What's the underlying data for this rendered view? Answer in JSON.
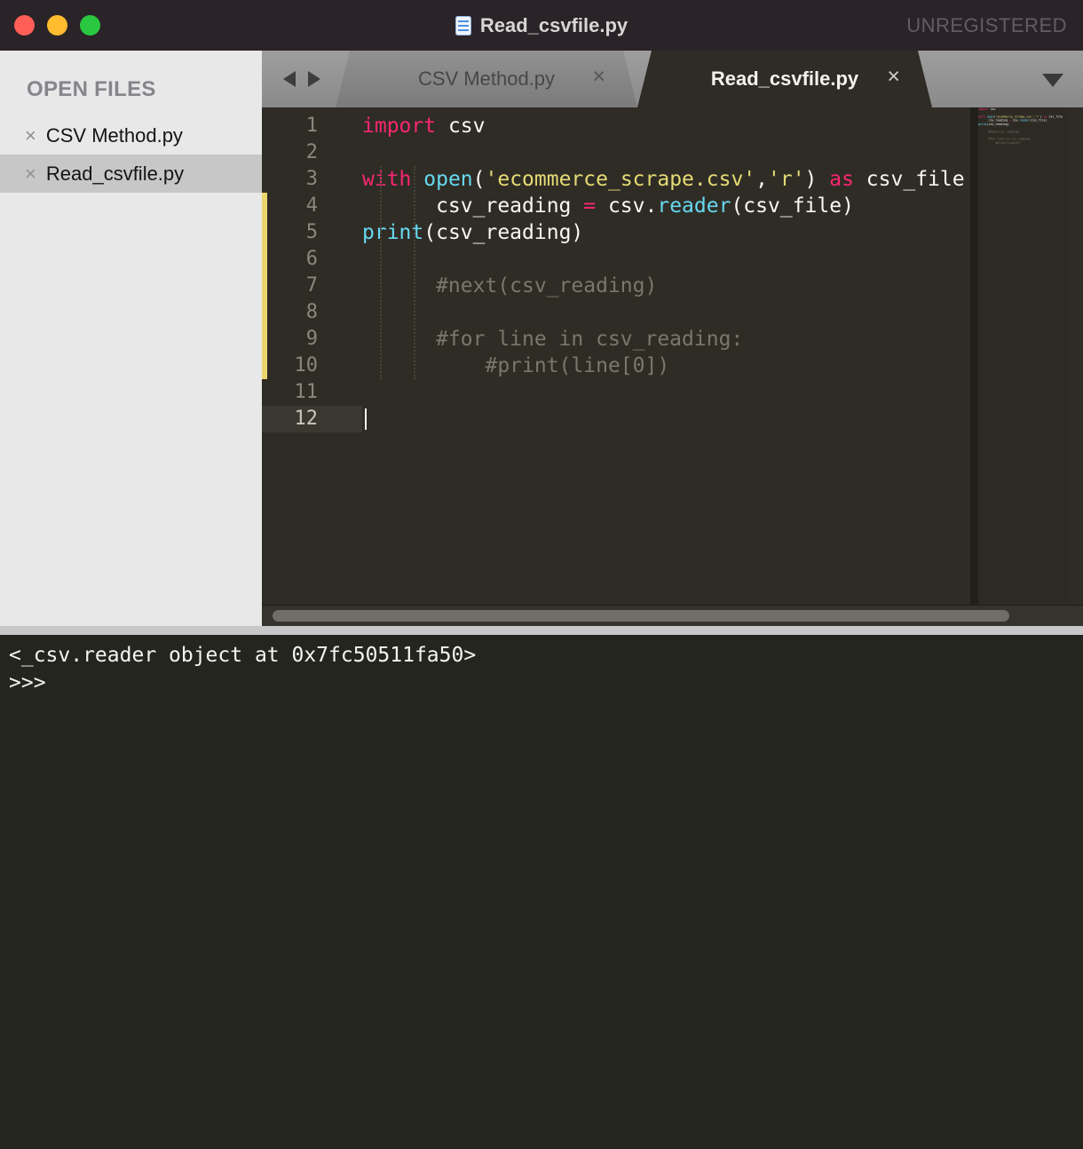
{
  "titlebar": {
    "title": "Read_csvfile.py",
    "registration": "UNREGISTERED"
  },
  "sidebar": {
    "heading": "OPEN FILES",
    "close_glyph": "×",
    "files": [
      {
        "name": "CSV Method.py",
        "selected": false
      },
      {
        "name": "Read_csvfile.py",
        "selected": true
      }
    ]
  },
  "tabstrip": {
    "close_glyph": "×",
    "tabs": [
      {
        "label": "CSV Method.py",
        "active": false
      },
      {
        "label": "Read_csvfile.py",
        "active": true
      }
    ]
  },
  "editor": {
    "current_line": "12",
    "lines": [
      {
        "n": "1",
        "segs": [
          [
            "kw",
            "import"
          ],
          [
            "pl",
            " csv"
          ]
        ]
      },
      {
        "n": "2",
        "segs": []
      },
      {
        "n": "3",
        "segs": [
          [
            "kw",
            "with"
          ],
          [
            "pl",
            " "
          ],
          [
            "fn",
            "open"
          ],
          [
            "pl",
            "("
          ],
          [
            "str",
            "'ecommerce_scrape.csv'"
          ],
          [
            "pl",
            ","
          ],
          [
            "str",
            "'r'"
          ],
          [
            "pl",
            ") "
          ],
          [
            "kw",
            "as"
          ],
          [
            "pl",
            " csv_file"
          ]
        ]
      },
      {
        "n": "4",
        "segs": [
          [
            "pl",
            "      csv_reading "
          ],
          [
            "kw",
            "="
          ],
          [
            "pl",
            " csv."
          ],
          [
            "fn",
            "reader"
          ],
          [
            "pl",
            "(csv_file)"
          ]
        ]
      },
      {
        "n": "5",
        "segs": [
          [
            "fn",
            "print"
          ],
          [
            "pl",
            "(csv_reading)"
          ]
        ]
      },
      {
        "n": "6",
        "segs": []
      },
      {
        "n": "7",
        "segs": [
          [
            "cm",
            "      #next(csv_reading)"
          ]
        ]
      },
      {
        "n": "8",
        "segs": []
      },
      {
        "n": "9",
        "segs": [
          [
            "cm",
            "      #for line in csv_reading:"
          ]
        ]
      },
      {
        "n": "10",
        "segs": [
          [
            "cm",
            "          #print(line[0])"
          ]
        ]
      },
      {
        "n": "11",
        "segs": []
      },
      {
        "n": "12",
        "segs": []
      }
    ]
  },
  "console": {
    "lines": [
      "<_csv.reader object at 0x7fc50511fa50>",
      ">>>"
    ]
  },
  "colors": {
    "keyword": "#f92672",
    "function": "#66d9ef",
    "string": "#e6db74",
    "plain": "#f8f8f2",
    "comment": "#7a776b",
    "modified_marker": "#ecd66c",
    "traffic_close": "#ff5f57",
    "traffic_minimize": "#febc2e",
    "traffic_zoom": "#2ac840"
  }
}
